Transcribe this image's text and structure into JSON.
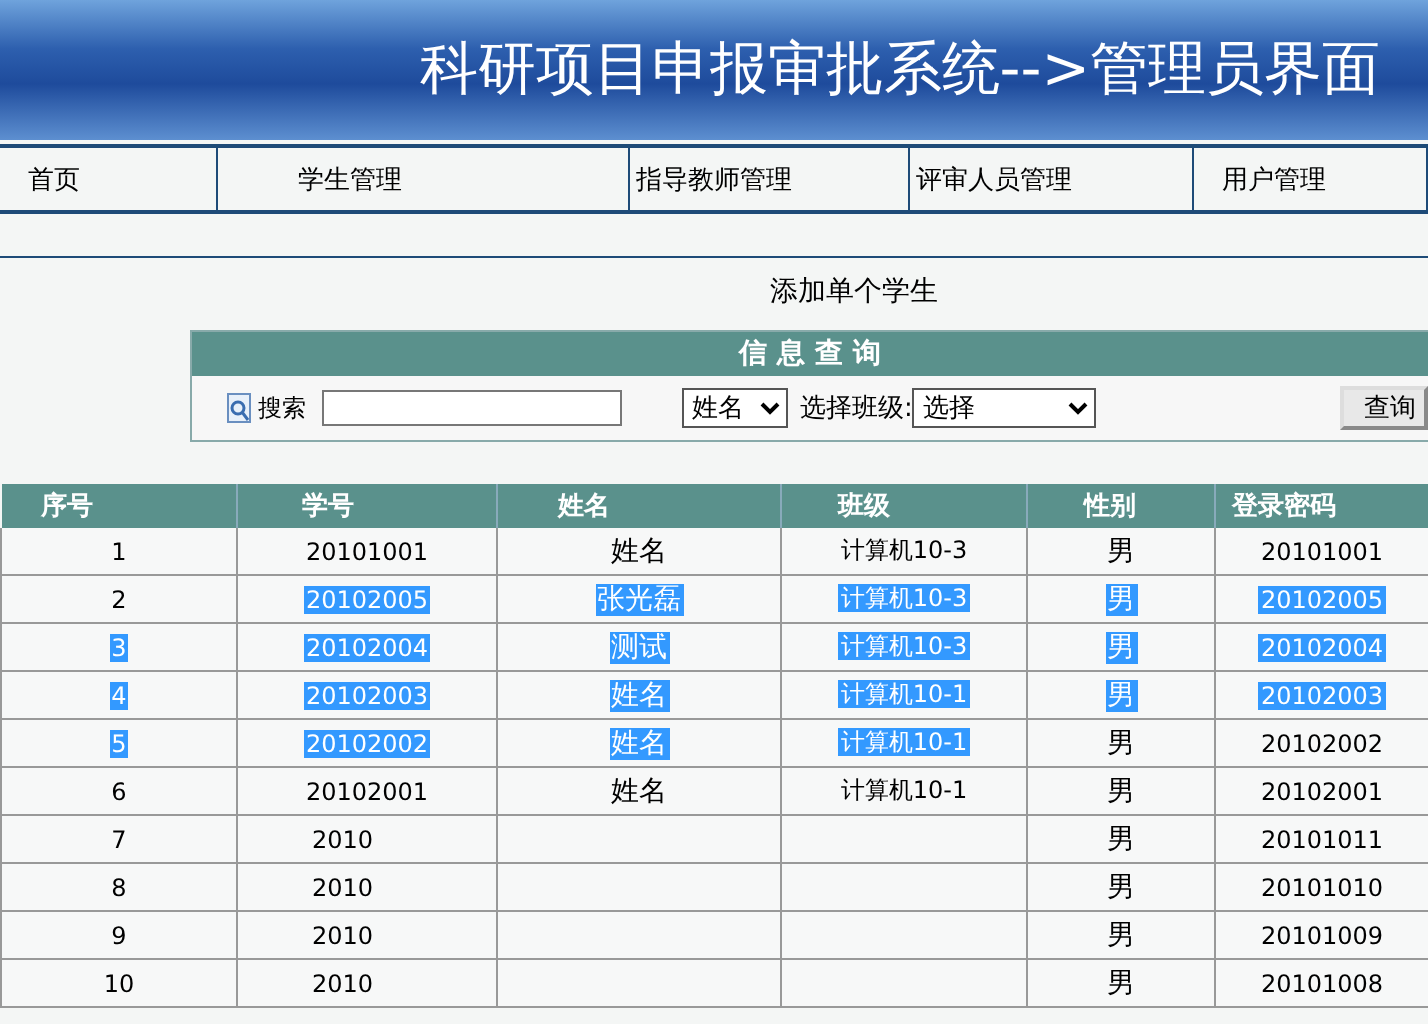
{
  "header": {
    "title": "科研项目申报审批系统-->管理员界面"
  },
  "nav": [
    {
      "label": "首页"
    },
    {
      "label": "学生管理"
    },
    {
      "label": "指导教师管理"
    },
    {
      "label": "评审人员管理"
    },
    {
      "label": "用户管理"
    }
  ],
  "add_link": "添加单个学生",
  "search_panel": {
    "title": "信 息 查 询",
    "search_label": "搜索",
    "field_select": "姓名",
    "class_label": "选择班级:",
    "class_select": "选择",
    "button": "查询"
  },
  "table": {
    "columns": [
      "序号",
      "学号",
      "姓名",
      "班级",
      "性别",
      "登录密码"
    ],
    "rows": [
      {
        "cells": [
          {
            "text": "1",
            "highlighted": false
          },
          {
            "text": "20101001",
            "highlighted": false
          },
          {
            "text": "姓名",
            "highlighted": false
          },
          {
            "text": "计算机10-3",
            "highlighted": false
          },
          {
            "text": "男",
            "highlighted": false
          },
          {
            "text": "20101001",
            "highlighted": false
          }
        ]
      },
      {
        "cells": [
          {
            "text": "2",
            "highlighted": false
          },
          {
            "text": "20102005",
            "highlighted": true
          },
          {
            "text": "张光磊",
            "highlighted": true
          },
          {
            "text": "计算机10-3",
            "highlighted": true
          },
          {
            "text": "男",
            "highlighted": true
          },
          {
            "text": "20102005",
            "highlighted": true
          }
        ]
      },
      {
        "cells": [
          {
            "text": "3",
            "highlighted": true
          },
          {
            "text": "20102004",
            "highlighted": true
          },
          {
            "text": "测试",
            "highlighted": true
          },
          {
            "text": "计算机10-3",
            "highlighted": true
          },
          {
            "text": "男",
            "highlighted": true
          },
          {
            "text": "20102004",
            "highlighted": true
          }
        ]
      },
      {
        "cells": [
          {
            "text": "4",
            "highlighted": true
          },
          {
            "text": "20102003",
            "highlighted": true
          },
          {
            "text": "姓名",
            "highlighted": true
          },
          {
            "text": "计算机10-1",
            "highlighted": true
          },
          {
            "text": "男",
            "highlighted": true
          },
          {
            "text": "20102003",
            "highlighted": true
          }
        ]
      },
      {
        "cells": [
          {
            "text": "5",
            "highlighted": true
          },
          {
            "text": "20102002",
            "highlighted": true
          },
          {
            "text": "姓名",
            "highlighted": true
          },
          {
            "text": "计算机10-1",
            "highlighted": true
          },
          {
            "text": "男",
            "highlighted": false
          },
          {
            "text": "20102002",
            "highlighted": false
          }
        ]
      },
      {
        "cells": [
          {
            "text": "6",
            "highlighted": false
          },
          {
            "text": "20102001",
            "highlighted": false
          },
          {
            "text": "姓名",
            "highlighted": false
          },
          {
            "text": "计算机10-1",
            "highlighted": false
          },
          {
            "text": "男",
            "highlighted": false
          },
          {
            "text": "20102001",
            "highlighted": false
          }
        ]
      },
      {
        "cells": [
          {
            "text": "7",
            "highlighted": false
          },
          {
            "text": "2010",
            "highlighted": false
          },
          null,
          null,
          {
            "text": "男",
            "highlighted": false
          },
          {
            "text": "20101011",
            "highlighted": false
          }
        ]
      },
      {
        "cells": [
          {
            "text": "8",
            "highlighted": false
          },
          {
            "text": "2010",
            "highlighted": false
          },
          null,
          null,
          {
            "text": "男",
            "highlighted": false
          },
          {
            "text": "20101010",
            "highlighted": false
          }
        ]
      },
      {
        "cells": [
          {
            "text": "9",
            "highlighted": false
          },
          {
            "text": "2010",
            "highlighted": false
          },
          null,
          null,
          {
            "text": "男",
            "highlighted": false
          },
          {
            "text": "20101009",
            "highlighted": false
          }
        ]
      },
      {
        "cells": [
          {
            "text": "10",
            "highlighted": false
          },
          {
            "text": "2010",
            "highlighted": false
          },
          null,
          null,
          {
            "text": "男",
            "highlighted": false
          },
          {
            "text": "20101008",
            "highlighted": false
          }
        ]
      }
    ]
  }
}
